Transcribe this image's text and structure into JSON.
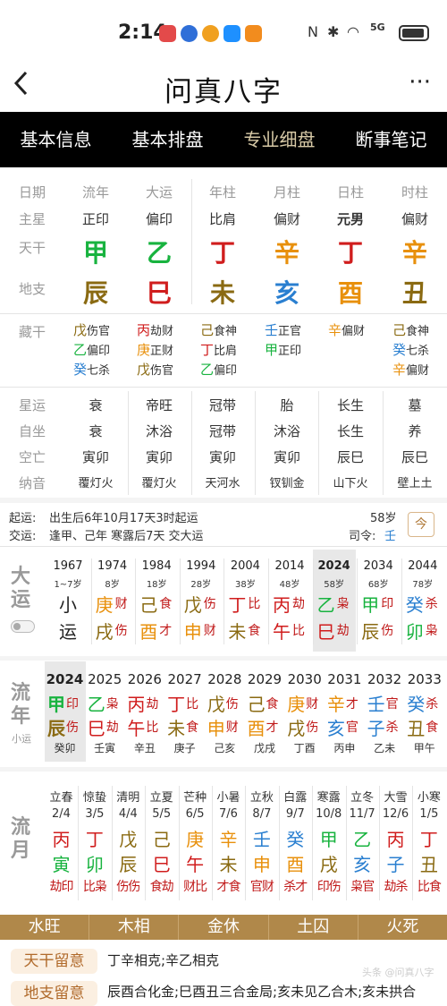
{
  "status": {
    "time": "2:14",
    "net": "5G"
  },
  "header": {
    "title": "问真八字",
    "back": "<",
    "more": "···"
  },
  "tabs": [
    "基本信息",
    "基本排盘",
    "专业细盘",
    "断事笔记"
  ],
  "pillars": {
    "row_labels": [
      "日期",
      "主星",
      "天干",
      "地支"
    ],
    "columns": [
      {
        "head": "流年",
        "star": "正印",
        "gan": "甲",
        "zhi": "辰",
        "gc": "#18b33f",
        "zc": "#8a6a12"
      },
      {
        "head": "大运",
        "star": "偏印",
        "gan": "乙",
        "zhi": "巳",
        "gc": "#18b33f",
        "zc": "#d01d1d"
      },
      {
        "head": "年柱",
        "star": "比肩",
        "gan": "丁",
        "zhi": "未",
        "gc": "#d01d1d",
        "zc": "#8a6a12"
      },
      {
        "head": "月柱",
        "star": "偏财",
        "gan": "辛",
        "zhi": "亥",
        "gc": "#e8900c",
        "zc": "#2a7fd0"
      },
      {
        "head": "日柱",
        "star": "元男",
        "gan": "丁",
        "zhi": "酉",
        "gc": "#d01d1d",
        "zc": "#e8900c"
      },
      {
        "head": "时柱",
        "star": "偏财",
        "gan": "辛",
        "zhi": "丑",
        "gc": "#e8900c",
        "zc": "#8a6a12"
      }
    ]
  },
  "canggan": {
    "label": "藏干",
    "columns": [
      [
        {
          "c": "戊",
          "s": "伤官",
          "k": "#8a6a12"
        },
        {
          "c": "乙",
          "s": "偏印",
          "k": "#18b33f"
        },
        {
          "c": "癸",
          "s": "七杀",
          "k": "#2a7fd0"
        }
      ],
      [
        {
          "c": "丙",
          "s": "劫财",
          "k": "#d01d1d"
        },
        {
          "c": "庚",
          "s": "正财",
          "k": "#e8900c"
        },
        {
          "c": "戊",
          "s": "伤官",
          "k": "#8a6a12"
        }
      ],
      [
        {
          "c": "己",
          "s": "食神",
          "k": "#8a6a12"
        },
        {
          "c": "丁",
          "s": "比肩",
          "k": "#d01d1d"
        },
        {
          "c": "乙",
          "s": "偏印",
          "k": "#18b33f"
        }
      ],
      [
        {
          "c": "壬",
          "s": "正官",
          "k": "#2a7fd0"
        },
        {
          "c": "甲",
          "s": "正印",
          "k": "#18b33f"
        }
      ],
      [
        {
          "c": "辛",
          "s": "偏财",
          "k": "#e8900c"
        }
      ],
      [
        {
          "c": "己",
          "s": "食神",
          "k": "#8a6a12"
        },
        {
          "c": "癸",
          "s": "七杀",
          "k": "#2a7fd0"
        },
        {
          "c": "辛",
          "s": "偏财",
          "k": "#e8900c"
        }
      ]
    ]
  },
  "info_rows": [
    {
      "label": "星运",
      "vals": [
        "衰",
        "帝旺",
        "冠带",
        "胎",
        "长生",
        "墓"
      ]
    },
    {
      "label": "自坐",
      "vals": [
        "衰",
        "沐浴",
        "冠带",
        "沐浴",
        "长生",
        "养"
      ]
    },
    {
      "label": "空亡",
      "vals": [
        "寅卯",
        "寅卯",
        "寅卯",
        "寅卯",
        "辰巳",
        "辰巳"
      ]
    },
    {
      "label": "纳音",
      "vals": [
        "覆灯火",
        "覆灯火",
        "天河水",
        "钗钏金",
        "山下火",
        "壁上土"
      ]
    }
  ],
  "qiyun": {
    "l1": "起运:",
    "t1": "出生后6年10月17天3时起运",
    "l2": "交运:",
    "t2": "逢甲、己年 寒露后7天 交大运",
    "age": "58岁",
    "siling": "司令:",
    "siling_val": "壬",
    "cal_icon": "今"
  },
  "dayun": {
    "label": "大运",
    "items": [
      {
        "year": "1967",
        "age": "1~7岁",
        "g": "小",
        "z": "运",
        "gs": "",
        "zs": "",
        "gk": "#222",
        "zk": "#222",
        "gsk": "#222",
        "zsk": "#222"
      },
      {
        "year": "1974",
        "age": "8岁",
        "g": "庚",
        "z": "戌",
        "gs": "财",
        "zs": "伤",
        "gk": "#e8900c",
        "zk": "#8a6a12"
      },
      {
        "year": "1984",
        "age": "18岁",
        "g": "己",
        "z": "酉",
        "gs": "食",
        "zs": "才",
        "gk": "#8a6a12",
        "zk": "#e8900c"
      },
      {
        "year": "1994",
        "age": "28岁",
        "g": "戊",
        "z": "申",
        "gs": "伤",
        "zs": "财",
        "gk": "#8a6a12",
        "zk": "#e8900c"
      },
      {
        "year": "2004",
        "age": "38岁",
        "g": "丁",
        "z": "未",
        "gs": "比",
        "zs": "食",
        "gk": "#d01d1d",
        "zk": "#8a6a12"
      },
      {
        "year": "2014",
        "age": "48岁",
        "g": "丙",
        "z": "午",
        "gs": "劫",
        "zs": "比",
        "gk": "#d01d1d",
        "zk": "#d01d1d"
      },
      {
        "year": "2024",
        "age": "58岁",
        "g": "乙",
        "z": "巳",
        "gs": "枭",
        "zs": "劫",
        "gk": "#18b33f",
        "zk": "#d01d1d"
      },
      {
        "year": "2034",
        "age": "68岁",
        "g": "甲",
        "z": "辰",
        "gs": "印",
        "zs": "伤",
        "gk": "#18b33f",
        "zk": "#8a6a12"
      },
      {
        "year": "2044",
        "age": "78岁",
        "g": "癸",
        "z": "卯",
        "gs": "杀",
        "zs": "枭",
        "gk": "#2a7fd0",
        "zk": "#18b33f"
      }
    ]
  },
  "liunian": {
    "label": "流年",
    "sub": "小运",
    "items": [
      {
        "year": "2024",
        "g": "甲",
        "z": "辰",
        "gs": "印",
        "zs": "伤",
        "gz": "癸卯",
        "gk": "#18b33f",
        "zk": "#8a6a12"
      },
      {
        "year": "2025",
        "g": "乙",
        "z": "巳",
        "gs": "枭",
        "zs": "劫",
        "gz": "壬寅",
        "gk": "#18b33f",
        "zk": "#d01d1d"
      },
      {
        "year": "2026",
        "g": "丙",
        "z": "午",
        "gs": "劫",
        "zs": "比",
        "gz": "辛丑",
        "gk": "#d01d1d",
        "zk": "#d01d1d"
      },
      {
        "year": "2027",
        "g": "丁",
        "z": "未",
        "gs": "比",
        "zs": "食",
        "gz": "庚子",
        "gk": "#d01d1d",
        "zk": "#8a6a12"
      },
      {
        "year": "2028",
        "g": "戊",
        "z": "申",
        "gs": "伤",
        "zs": "财",
        "gz": "己亥",
        "gk": "#8a6a12",
        "zk": "#e8900c"
      },
      {
        "year": "2029",
        "g": "己",
        "z": "酉",
        "gs": "食",
        "zs": "才",
        "gz": "戊戌",
        "gk": "#8a6a12",
        "zk": "#e8900c"
      },
      {
        "year": "2030",
        "g": "庚",
        "z": "戌",
        "gs": "财",
        "zs": "伤",
        "gz": "丁酉",
        "gk": "#e8900c",
        "zk": "#8a6a12"
      },
      {
        "year": "2031",
        "g": "辛",
        "z": "亥",
        "gs": "才",
        "zs": "官",
        "gz": "丙申",
        "gk": "#e8900c",
        "zk": "#2a7fd0"
      },
      {
        "year": "2032",
        "g": "壬",
        "z": "子",
        "gs": "官",
        "zs": "杀",
        "gz": "乙未",
        "gk": "#2a7fd0",
        "zk": "#2a7fd0"
      },
      {
        "year": "2033",
        "g": "癸",
        "z": "丑",
        "gs": "杀",
        "zs": "食",
        "gz": "甲午",
        "gk": "#2a7fd0",
        "zk": "#8a6a12"
      }
    ]
  },
  "liuyue": {
    "label": "流月",
    "items": [
      {
        "term": "立春",
        "date": "2/4",
        "g": "丙",
        "z": "寅",
        "ss": "劫印",
        "gk": "#d01d1d",
        "zk": "#18b33f"
      },
      {
        "term": "惊蛰",
        "date": "3/5",
        "g": "丁",
        "z": "卯",
        "ss": "比枭",
        "gk": "#d01d1d",
        "zk": "#18b33f"
      },
      {
        "term": "清明",
        "date": "4/4",
        "g": "戊",
        "z": "辰",
        "ss": "伤伤",
        "gk": "#8a6a12",
        "zk": "#8a6a12"
      },
      {
        "term": "立夏",
        "date": "5/5",
        "g": "己",
        "z": "巳",
        "ss": "食劫",
        "gk": "#8a6a12",
        "zk": "#d01d1d"
      },
      {
        "term": "芒种",
        "date": "6/5",
        "g": "庚",
        "z": "午",
        "ss": "财比",
        "gk": "#e8900c",
        "zk": "#d01d1d"
      },
      {
        "term": "小暑",
        "date": "7/6",
        "g": "辛",
        "z": "未",
        "ss": "才食",
        "gk": "#e8900c",
        "zk": "#8a6a12"
      },
      {
        "term": "立秋",
        "date": "8/7",
        "g": "壬",
        "z": "申",
        "ss": "官财",
        "gk": "#2a7fd0",
        "zk": "#e8900c"
      },
      {
        "term": "白露",
        "date": "9/7",
        "g": "癸",
        "z": "酉",
        "ss": "杀才",
        "gk": "#2a7fd0",
        "zk": "#e8900c"
      },
      {
        "term": "寒露",
        "date": "10/8",
        "g": "甲",
        "z": "戌",
        "ss": "印伤",
        "gk": "#18b33f",
        "zk": "#8a6a12"
      },
      {
        "term": "立冬",
        "date": "11/7",
        "g": "乙",
        "z": "亥",
        "ss": "枭官",
        "gk": "#18b33f",
        "zk": "#2a7fd0"
      },
      {
        "term": "大雪",
        "date": "12/6",
        "g": "丙",
        "z": "子",
        "ss": "劫杀",
        "gk": "#d01d1d",
        "zk": "#2a7fd0"
      },
      {
        "term": "小寒",
        "date": "1/5",
        "g": "丁",
        "z": "丑",
        "ss": "比食",
        "gk": "#d01d1d",
        "zk": "#8a6a12"
      }
    ]
  },
  "wuxing": [
    "水旺",
    "木相",
    "金休",
    "土囚",
    "火死"
  ],
  "notes": [
    {
      "tag": "天干留意",
      "text": "丁辛相克;辛乙相克"
    },
    {
      "tag": "地支留意",
      "text": "辰酉合化金;巳酉丑三合金局;亥未见乙合木;亥未拱合"
    }
  ],
  "watermark": "头条 @问真八字"
}
